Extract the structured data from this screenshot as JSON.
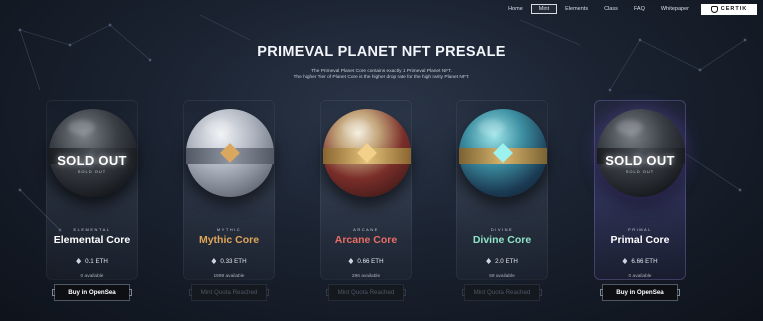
{
  "nav": {
    "items": [
      "Home",
      "Mint",
      "Elements",
      "Class",
      "FAQ",
      "Whitepaper"
    ],
    "active": "Mint",
    "certik_label": "CERTIK"
  },
  "header": {
    "title": "PRIMEVAL PLANET NFT PRESALE",
    "subtitle_line1": "The Primeval Planet Core contains exactly 1 Primeval Planet NFT.",
    "subtitle_line2": "The higher Tier of Planet Core is the higher drop rate for the high rarity Planet NFT."
  },
  "cards": [
    {
      "key": "elemental",
      "rune": "ELEMENTAL",
      "name": "Elemental Core",
      "price": "0.1 ETH",
      "availability": "0 available",
      "sold_out": true,
      "sold_out_label": "SOLD OUT",
      "sold_out_sub": "SOLD OUT",
      "button": "Buy in OpenSea",
      "button_active": true
    },
    {
      "key": "mythic",
      "rune": "MYTHIC",
      "name": "Mythic Core",
      "price": "0.33 ETH",
      "availability": "1699 available",
      "sold_out": false,
      "button": "Mint Quota Reached",
      "button_active": false
    },
    {
      "key": "arcane",
      "rune": "ARCANE",
      "name": "Arcane Core",
      "price": "0.66 ETH",
      "availability": "296 available",
      "sold_out": false,
      "button": "Mint Quota Reached",
      "button_active": false
    },
    {
      "key": "divine",
      "rune": "DIVINE",
      "name": "Divine Core",
      "price": "2.0 ETH",
      "availability": "59 available",
      "sold_out": false,
      "button": "Mint Quota Reached",
      "button_active": false
    },
    {
      "key": "primal",
      "rune": "PRIMAL",
      "name": "Primal Core",
      "price": "6.66 ETH",
      "availability": "0 available",
      "sold_out": true,
      "sold_out_label": "SOLD OUT",
      "sold_out_sub": "SOLD OUT",
      "button": "Buy in OpenSea",
      "button_active": true
    }
  ],
  "colors": {
    "mythic": "#e0a65a",
    "arcane": "#e86d64",
    "divine": "#8fe3c6",
    "background": "#1a2230"
  }
}
